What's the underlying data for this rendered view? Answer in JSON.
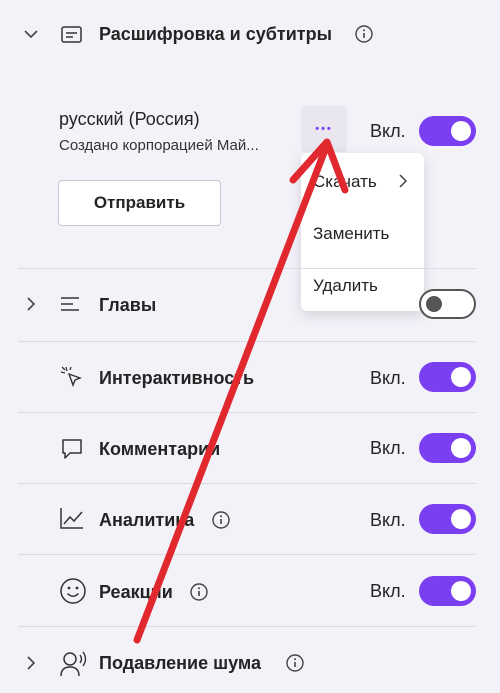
{
  "transcript_section": {
    "title": "Расшифровка и субтитры",
    "language": "русский (Россия)",
    "created_by": "Создано корпорацией Май...",
    "send_button": "Отправить",
    "more_button": "•••",
    "toggle_label": "Вкл.",
    "toggle_on": true
  },
  "context_menu": {
    "download": "Скачать",
    "replace": "Заменить",
    "delete": "Удалить"
  },
  "rows": {
    "chapters": {
      "label": "Главы",
      "on": false
    },
    "interactivity": {
      "label": "Интерактивность",
      "state_label": "Вкл.",
      "on": true
    },
    "comments": {
      "label": "Комментарии",
      "state_label": "Вкл.",
      "on": true
    },
    "analytics": {
      "label": "Аналитика",
      "state_label": "Вкл.",
      "on": true
    },
    "reactions": {
      "label": "Реакции",
      "state_label": "Вкл.",
      "on": true
    },
    "noise": {
      "label": "Подавление шума"
    }
  },
  "colors": {
    "accent": "#7b3ff2",
    "background": "#f4f2f9",
    "arrow": "#e0282e"
  }
}
